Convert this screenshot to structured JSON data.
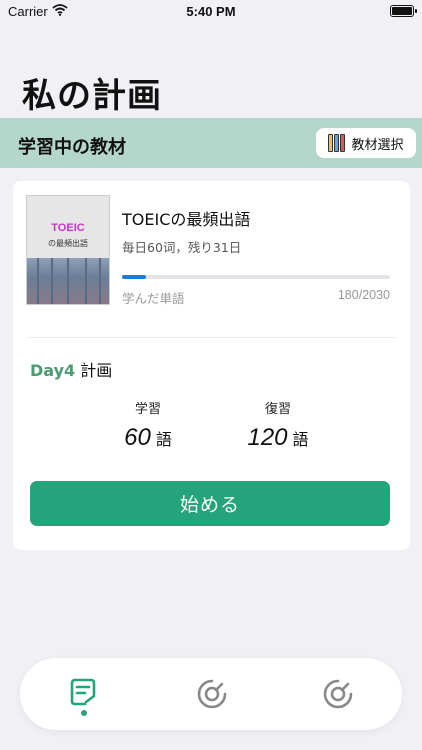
{
  "status_bar": {
    "carrier": "Carrier",
    "time": "5:40 PM"
  },
  "page": {
    "title": "私の計画"
  },
  "section": {
    "label": "学習中の教材",
    "material_button": "教材選択"
  },
  "book": {
    "cover_title": "TOEIC",
    "cover_subtitle": "の最頻出語",
    "name": "TOEICの最頻出語",
    "description": "毎日60词，残り31日",
    "learned_label": "学んだ単語",
    "learned_count": "180/2030",
    "progress": 0.0887
  },
  "plan": {
    "day": "Day4",
    "heading": "計画",
    "study_label": "学習",
    "study_value": "60",
    "review_label": "復習",
    "review_value": "120",
    "unit": "語",
    "start_button": "始める"
  },
  "colors": {
    "accent": "#25a37a",
    "band": "#b5d6cb",
    "progress": "#1e7bd6",
    "day": "#4a9a73"
  },
  "tabbar": {
    "icons": [
      "plan-tab-icon",
      "gauge-icon",
      "gauge-icon"
    ],
    "selected": 0
  }
}
